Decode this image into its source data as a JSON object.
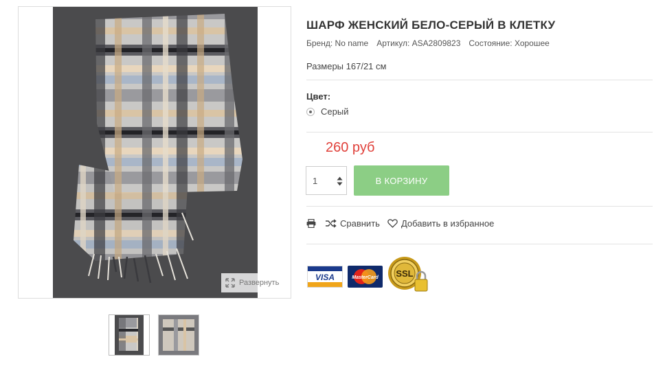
{
  "product": {
    "title": "ШАРФ ЖЕНСКИЙ БЕЛО-СЕРЫЙ В КЛЕТКУ",
    "brand_label": "Бренд:",
    "brand_value": "No name",
    "sku_label": "Артикул:",
    "sku_value": "ASA2809823",
    "condition_label": "Состояние:",
    "condition_value": "Хорошее",
    "sizes": "Размеры 167/21 см",
    "color_label": "Цвет:",
    "color_option": "Серый",
    "price": "260 руб",
    "quantity": "1",
    "add_to_cart": "В КОРЗИНУ"
  },
  "gallery": {
    "expand_label": "Развернуть",
    "thumbnail_count": 2,
    "selected_thumbnail": 1
  },
  "actions": {
    "print_icon": "print-icon",
    "compare_label": "Сравнить",
    "favorite_label": "Добавить в избранное"
  },
  "payments": {
    "visa_text": "VISA",
    "mastercard_text": "MasterCard",
    "ssl_text": "SSL"
  },
  "colors": {
    "price": "#e0403a",
    "cart_button": "#8cce85",
    "photo_background": "#4b4b4d"
  }
}
